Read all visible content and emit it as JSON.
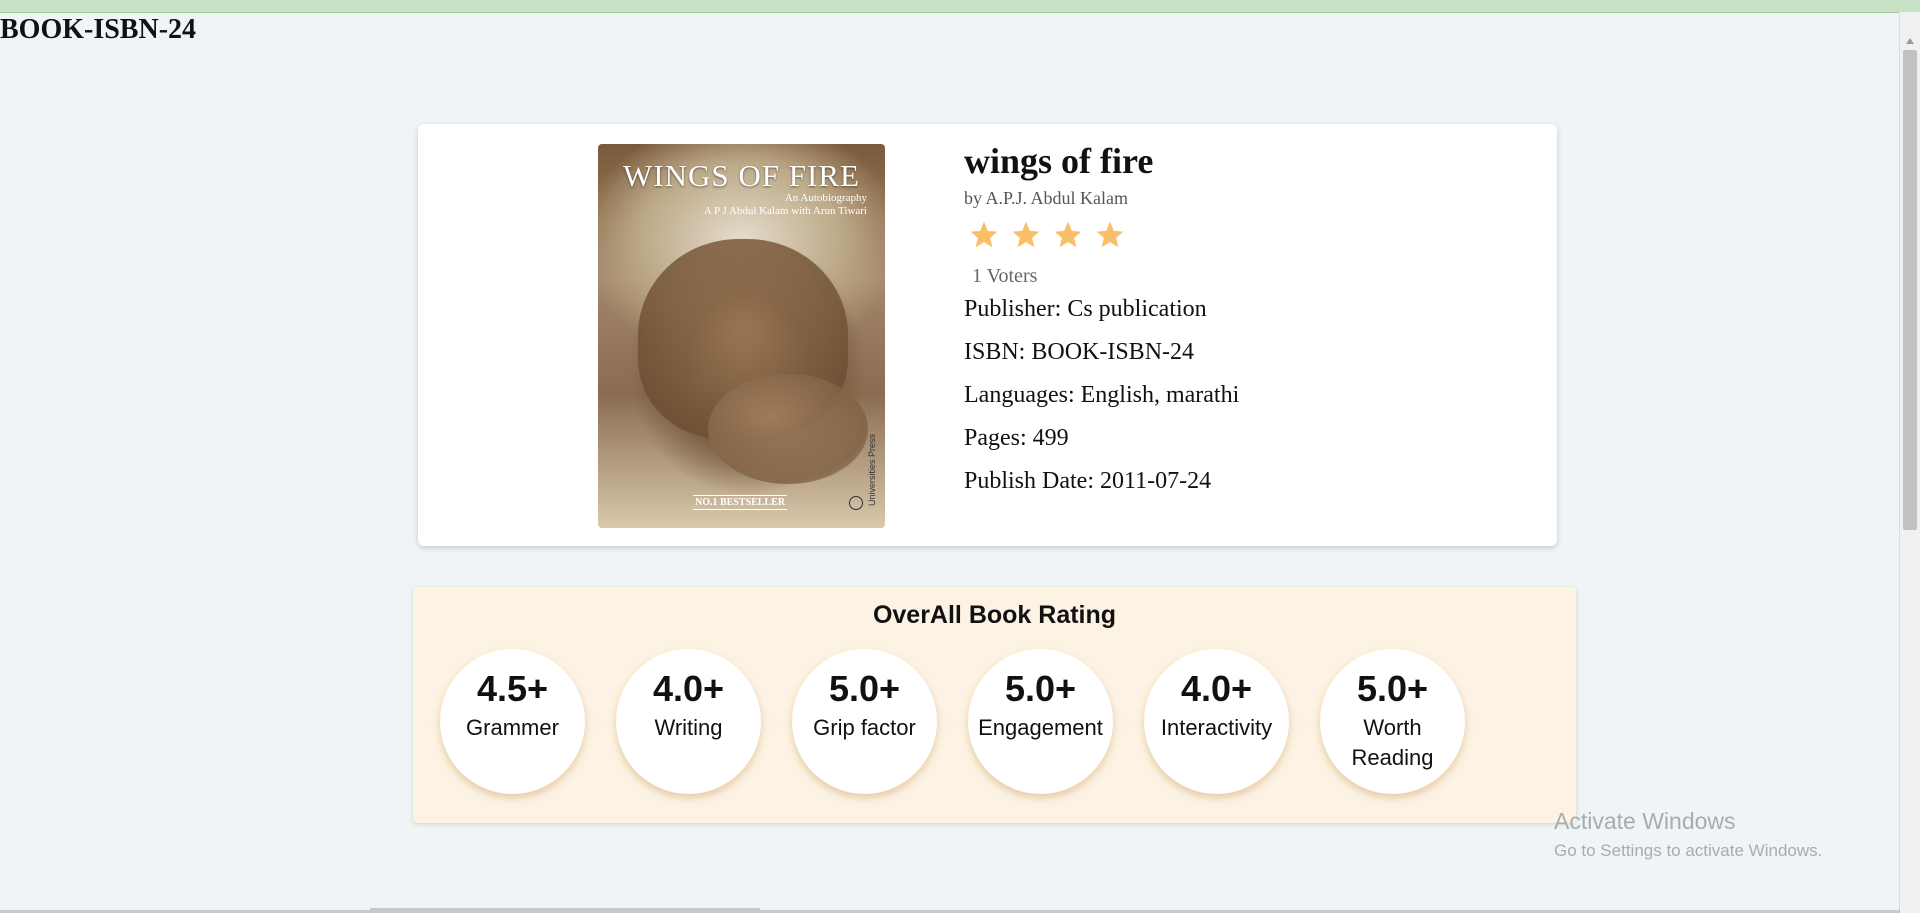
{
  "page": {
    "heading": "BOOK-ISBN-24"
  },
  "book": {
    "cover": {
      "title": "WINGS OF FIRE",
      "subtitle": "An Autobiography",
      "authors": "A P J Abdul Kalam with Arun Tiwari",
      "badge": "NO.1 BESTSELLER",
      "publisher": "Universities Press"
    },
    "title": "wings of fire",
    "author": "by A.P.J. Abdul Kalam",
    "stars_filled": 4,
    "voters": "1 Voters",
    "publisher": "Publisher: Cs publication",
    "isbn": "ISBN: BOOK-ISBN-24",
    "languages": "Languages: English, marathi",
    "pages": "Pages: 499",
    "publish_date": "Publish Date: 2011-07-24"
  },
  "rating": {
    "heading": "OverAll Book Rating",
    "items": [
      {
        "score": "4.5+",
        "label": "Grammer"
      },
      {
        "score": "4.0+",
        "label": "Writing"
      },
      {
        "score": "5.0+",
        "label": "Grip factor"
      },
      {
        "score": "5.0+",
        "label": "Engagement"
      },
      {
        "score": "4.0+",
        "label": "Interactivity"
      },
      {
        "score": "5.0+",
        "label": "Worth Reading"
      }
    ]
  },
  "colors": {
    "star": "#fbbf6a",
    "panel": "#fdf3e4",
    "topbar": "#c7e2c6"
  },
  "watermark": {
    "line1": "Activate Windows",
    "line2": "Go to Settings to activate Windows."
  }
}
